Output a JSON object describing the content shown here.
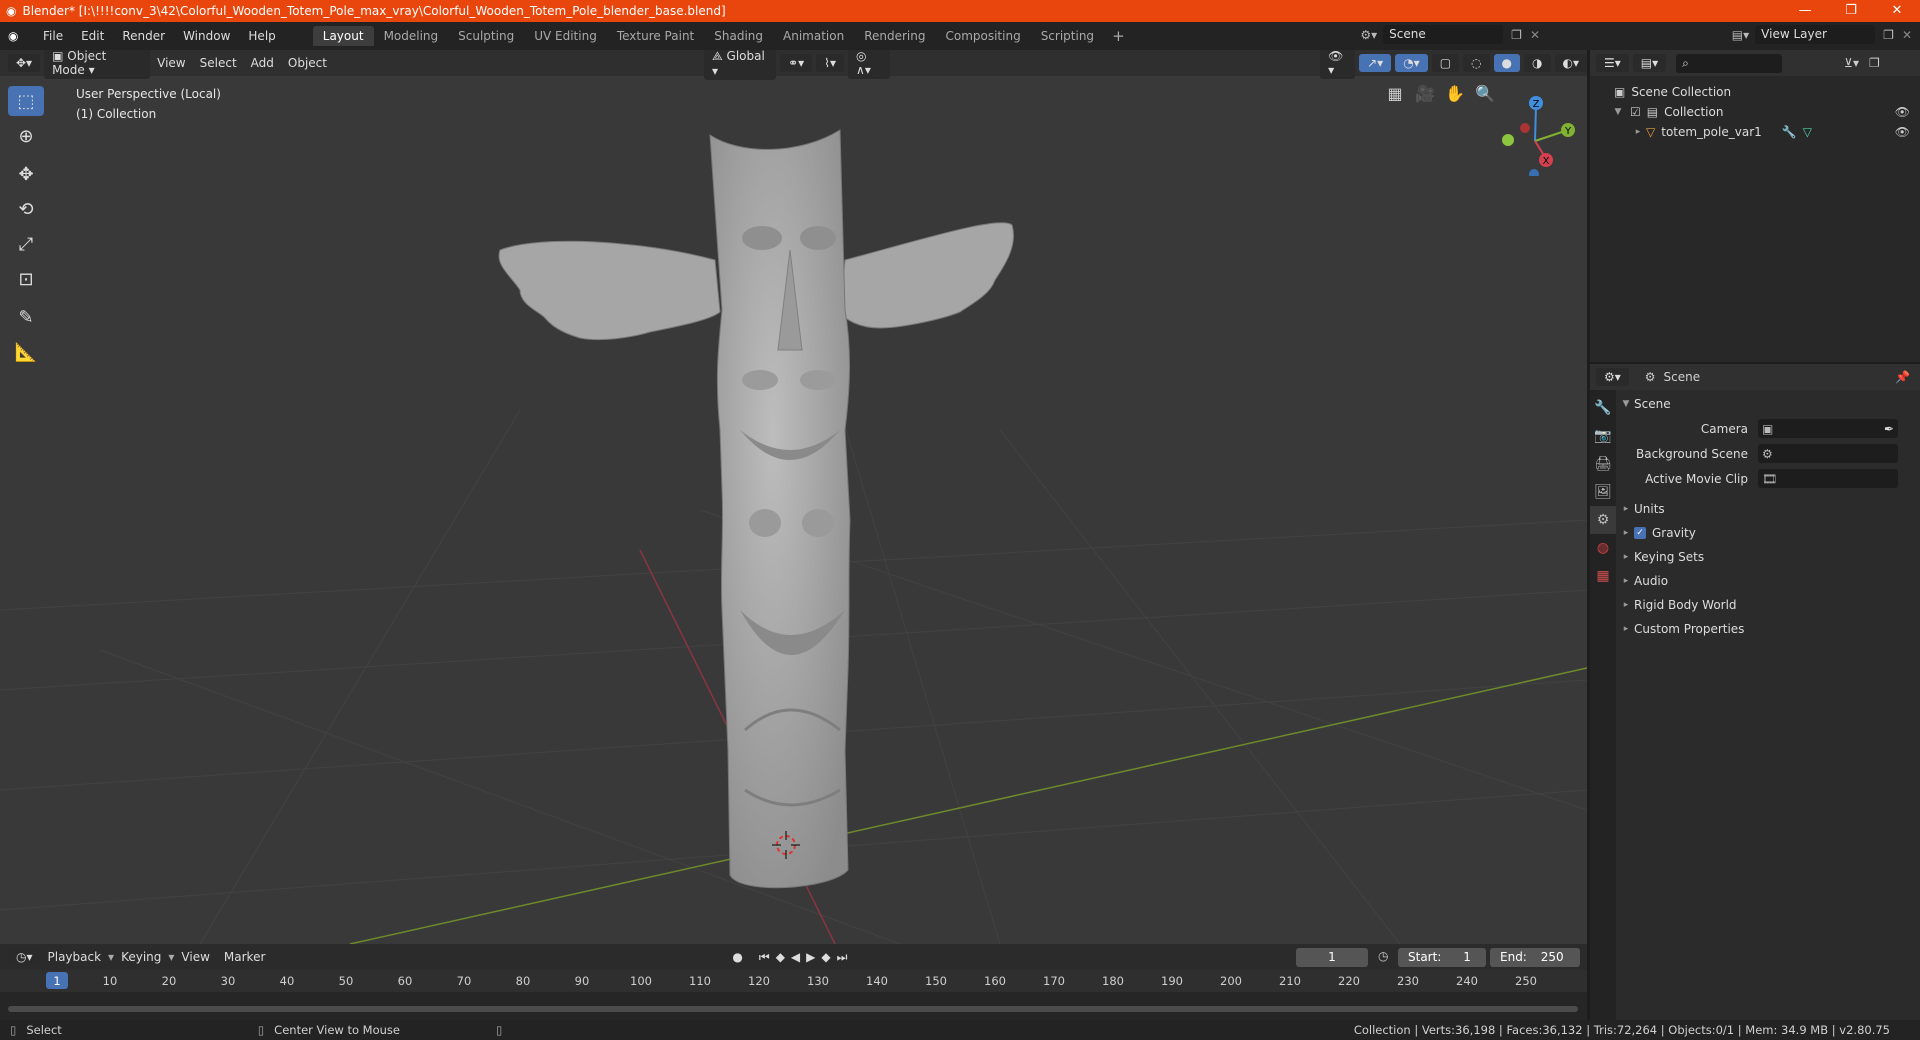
{
  "window": {
    "title": "Blender* [I:\\!!!!conv_3\\42\\Colorful_Wooden_Totem_Pole_max_vray\\Colorful_Wooden_Totem_Pole_blender_base.blend]",
    "minimize": "—",
    "maximize": "❐",
    "close": "✕"
  },
  "menu": [
    "File",
    "Edit",
    "Render",
    "Window",
    "Help"
  ],
  "workspaces": [
    "Layout",
    "Modeling",
    "Sculpting",
    "UV Editing",
    "Texture Paint",
    "Shading",
    "Animation",
    "Rendering",
    "Compositing",
    "Scripting"
  ],
  "workspace_active": "Layout",
  "scene_name": "Scene",
  "view_layer": "View Layer",
  "viewport": {
    "mode": "Object Mode",
    "menus": [
      "View",
      "Select",
      "Add",
      "Object"
    ],
    "transform_orientation": "Global",
    "info_line1": "User Perspective (Local)",
    "info_line2": "(1) Collection",
    "gizmo": {
      "z": "Z",
      "y": "Y",
      "x": "X"
    }
  },
  "timeline": {
    "menus": [
      "Playback",
      "Keying",
      "View",
      "Marker"
    ],
    "current_frame": "1",
    "start_label": "Start:",
    "start": "1",
    "end_label": "End:",
    "end": "250",
    "ruler": [
      "1",
      "10",
      "20",
      "30",
      "40",
      "50",
      "60",
      "70",
      "80",
      "90",
      "100",
      "110",
      "120",
      "130",
      "140",
      "150",
      "160",
      "170",
      "180",
      "190",
      "200",
      "210",
      "220",
      "230",
      "240",
      "250"
    ]
  },
  "status": {
    "select": "Select",
    "center": "Center View to Mouse",
    "info": "Collection | Verts:36,198 | Faces:36,132 | Tris:72,264 | Objects:0/1 | Mem: 34.9 MB | v2.80.75"
  },
  "outliner": {
    "root": "Scene Collection",
    "collection": "Collection",
    "object": "totem_pole_var1"
  },
  "properties": {
    "header": "Scene",
    "panel": "Scene",
    "camera_label": "Camera",
    "background_label": "Background Scene",
    "movieclip_label": "Active Movie Clip",
    "subpanels": [
      "Units",
      "Gravity",
      "Keying Sets",
      "Audio",
      "Rigid Body World",
      "Custom Properties"
    ]
  },
  "colors": {
    "titlebar": "#e8460c",
    "active_blue": "#4772b3",
    "viewport_bg": "#393939",
    "x_axis": "#d5404f",
    "y_axis": "#82b232",
    "z_axis": "#3f8fe0"
  }
}
